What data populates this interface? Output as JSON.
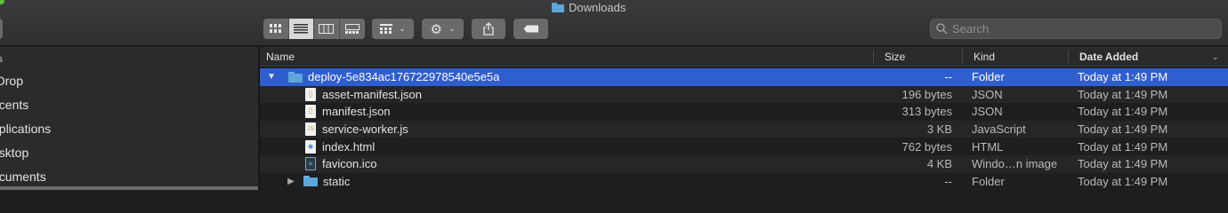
{
  "window": {
    "title": "Downloads"
  },
  "toolbar": {
    "view_modes": [
      "icon-view",
      "list-view",
      "column-view",
      "gallery-view"
    ],
    "active_view": "list-view"
  },
  "search": {
    "placeholder": "Search"
  },
  "sidebar": {
    "heading": "s",
    "items": [
      {
        "label": "rDrop"
      },
      {
        "label": "ecents"
      },
      {
        "label": "pplications"
      },
      {
        "label": "esktop"
      },
      {
        "label": "ocuments"
      }
    ]
  },
  "columns": {
    "name": "Name",
    "size": "Size",
    "kind": "Kind",
    "date": "Date Added"
  },
  "rows": [
    {
      "name": "deploy-5e834ac176722978540e5e5a",
      "size": "--",
      "kind": "Folder",
      "date": "Today at 1:49 PM",
      "icon": "folder-icon",
      "disclosure": "▼"
    },
    {
      "name": "asset-manifest.json",
      "size": "196 bytes",
      "kind": "JSON",
      "date": "Today at 1:49 PM",
      "icon": "json-file-icon"
    },
    {
      "name": "manifest.json",
      "size": "313 bytes",
      "kind": "JSON",
      "date": "Today at 1:49 PM",
      "icon": "json-file-icon"
    },
    {
      "name": "service-worker.js",
      "size": "3 KB",
      "kind": "JavaScript",
      "date": "Today at 1:49 PM",
      "icon": "js-file-icon"
    },
    {
      "name": "index.html",
      "size": "762 bytes",
      "kind": "HTML",
      "date": "Today at 1:49 PM",
      "icon": "html-file-icon"
    },
    {
      "name": "favicon.ico",
      "size": "4 KB",
      "kind": "Windo…n image",
      "date": "Today at 1:49 PM",
      "icon": "ico-file-icon"
    },
    {
      "name": "static",
      "size": "--",
      "kind": "Folder",
      "date": "Today at 1:49 PM",
      "icon": "folder-icon",
      "disclosure": "▶"
    }
  ],
  "colors": {
    "selection": "#2f5ecf",
    "folder": "#5ea6d8"
  }
}
